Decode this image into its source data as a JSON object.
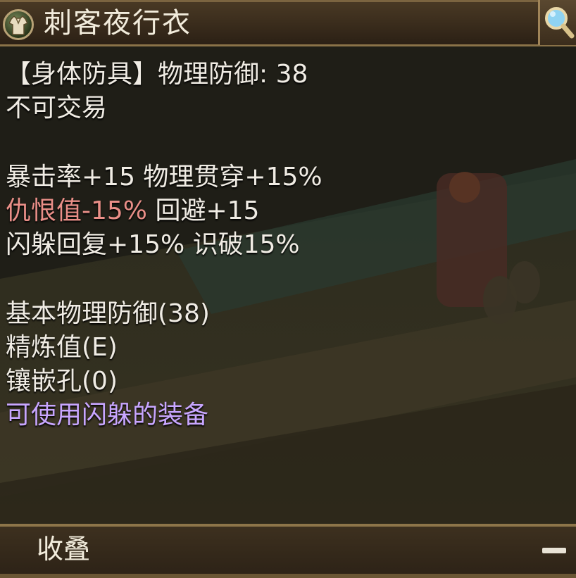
{
  "item": {
    "title": "刺客夜行衣",
    "icon": "armor-shirt-icon",
    "zoom_icon": "magnifier-icon"
  },
  "lines": {
    "type_defense": "【身体防具】物理防御: 38",
    "trade": "不可交易",
    "stat_crit": "暴击率+15 物理贯穿+15%",
    "stat_hate": "仇恨值-15%",
    "stat_evade": " 回避+15",
    "stat_dodge": "闪躲回复+15% 识破15%",
    "base_defense": "基本物理防御(38)",
    "refine": "精炼值(E)",
    "socket": "镶嵌孔(0)",
    "dodge_equip": "可使用闪躲的装备"
  },
  "footer": {
    "collapse_label": "收叠",
    "minus_icon": "minus-icon"
  },
  "colors": {
    "normal_text": "#f0ece4",
    "penalty_text": "#ea8f88",
    "special_text": "#c8a6ff",
    "frame": "#8a7248"
  }
}
